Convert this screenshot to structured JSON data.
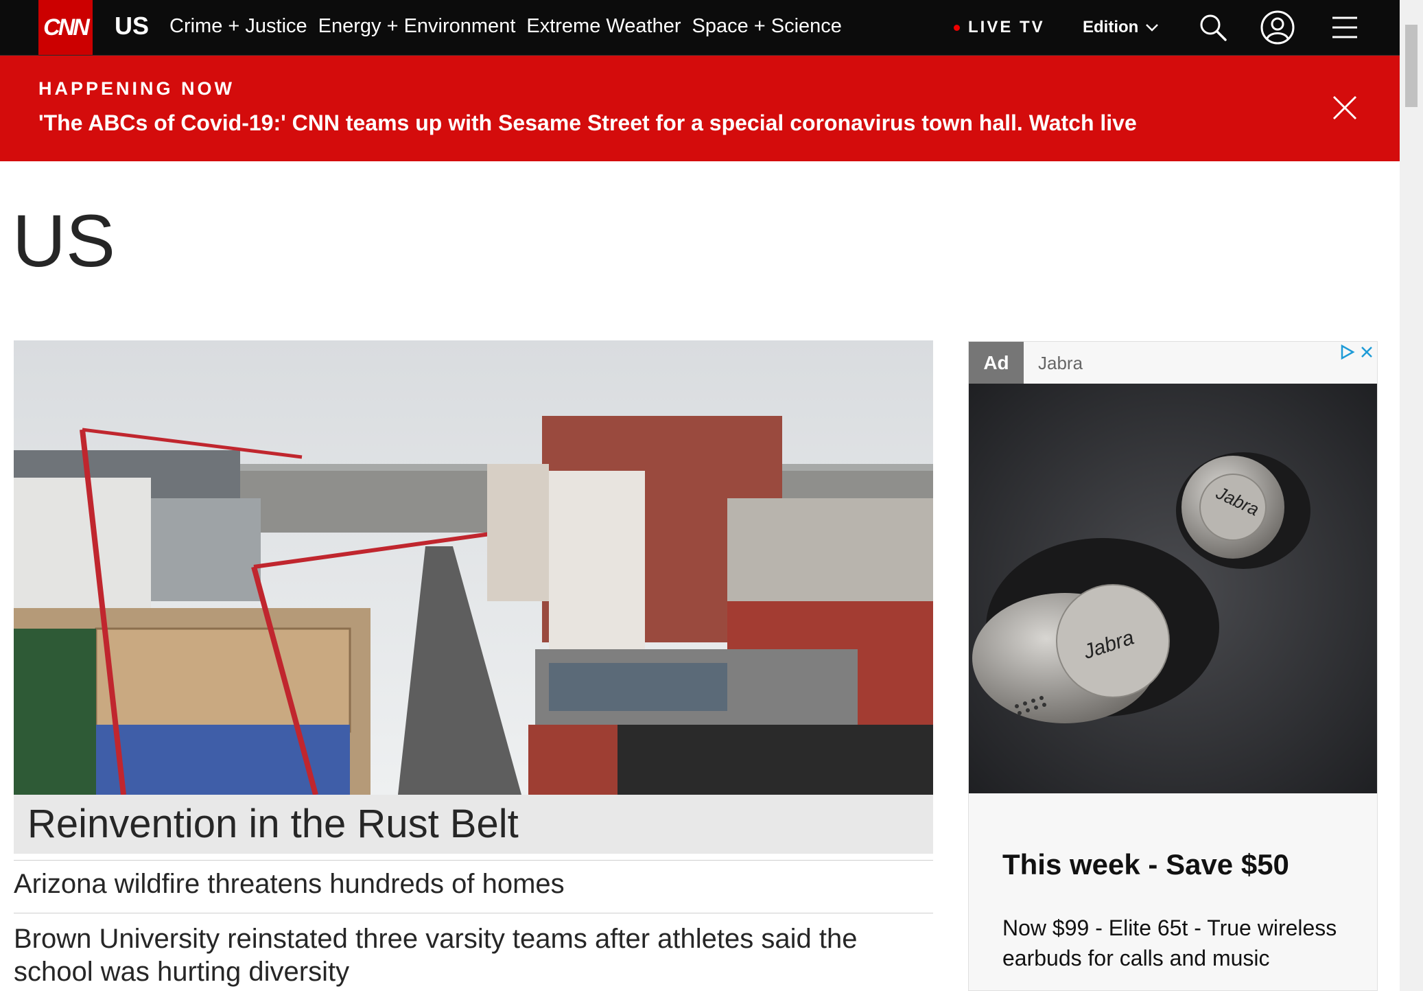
{
  "header": {
    "logo_text": "CNN",
    "section": "US",
    "nav_links": [
      "Crime + Justice",
      "Energy + Environment",
      "Extreme Weather",
      "Space + Science"
    ],
    "live_tv": "LIVE TV",
    "edition": "Edition",
    "icons": [
      "search-icon",
      "account-icon",
      "menu-icon",
      "chevron-down-icon"
    ]
  },
  "breaking": {
    "label": "HAPPENING NOW",
    "headline": "'The ABCs of Covid-19:' CNN teams up with Sesame Street for a special coronavirus town hall. Watch live"
  },
  "page": {
    "title": "US"
  },
  "hero": {
    "caption": "Reinvention in the Rust Belt"
  },
  "headlines": [
    "Arizona wildfire threatens hundreds of homes",
    "Brown University reinstated three varsity teams after athletes said the school was hurting diversity"
  ],
  "ad": {
    "badge": "Ad",
    "advertiser": "Jabra",
    "product_text": "Jabra",
    "headline": "This week - Save $50",
    "body": "Now $99 - Elite 65t - True wireless earbuds for calls and music"
  },
  "colors": {
    "nav_bg": "#0c0c0c",
    "brand_red": "#cc0000",
    "breaking_red": "#d40c0c",
    "text_dark": "#262626"
  }
}
